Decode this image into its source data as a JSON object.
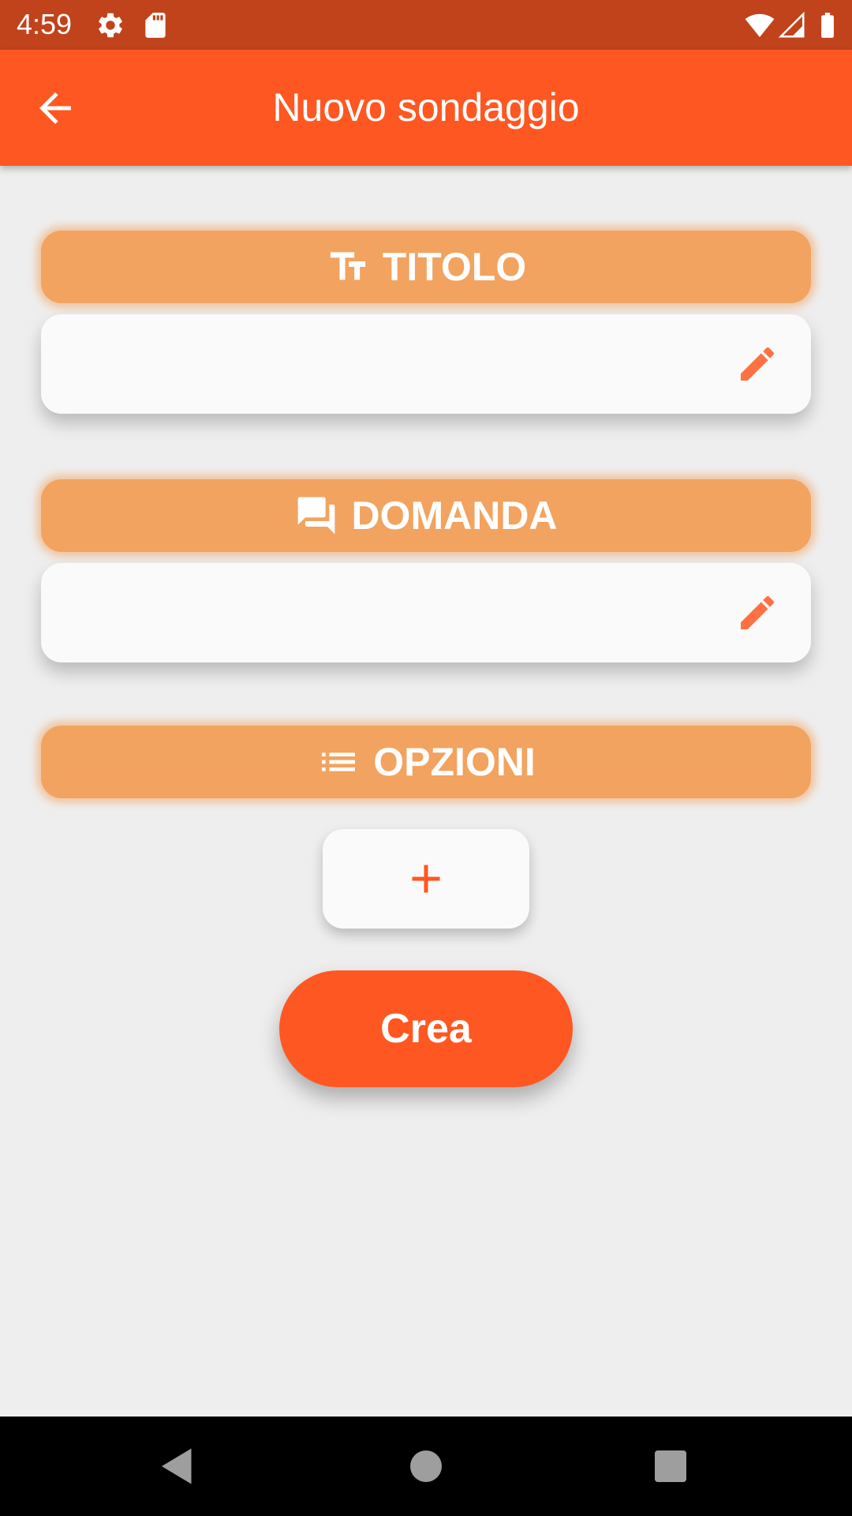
{
  "status_bar": {
    "time": "4:59",
    "icons": [
      "settings-icon",
      "sd-card-icon",
      "wifi-icon",
      "signal-icon",
      "battery-icon"
    ]
  },
  "app_bar": {
    "title": "Nuovo sondaggio",
    "back_icon": "arrow-back-icon"
  },
  "sections": {
    "title": {
      "label": "TITOLO",
      "icon": "text-fields-icon",
      "value": "",
      "placeholder": ""
    },
    "question": {
      "label": "DOMANDA",
      "icon": "forum-icon",
      "value": "",
      "placeholder": ""
    },
    "options": {
      "label": "OPZIONI",
      "icon": "list-icon"
    }
  },
  "add_option": {
    "icon": "plus-icon"
  },
  "create_button": {
    "label": "Crea"
  },
  "nav_bar": {
    "icons": [
      "back-triangle-icon",
      "home-circle-icon",
      "recents-square-icon"
    ]
  },
  "colors": {
    "status_bar": "#c0431c",
    "primary": "#ff5722",
    "section_header": "#f2a35f",
    "card": "#fafafa",
    "background": "#eeeeee",
    "edit_icon": "#ff7043"
  }
}
